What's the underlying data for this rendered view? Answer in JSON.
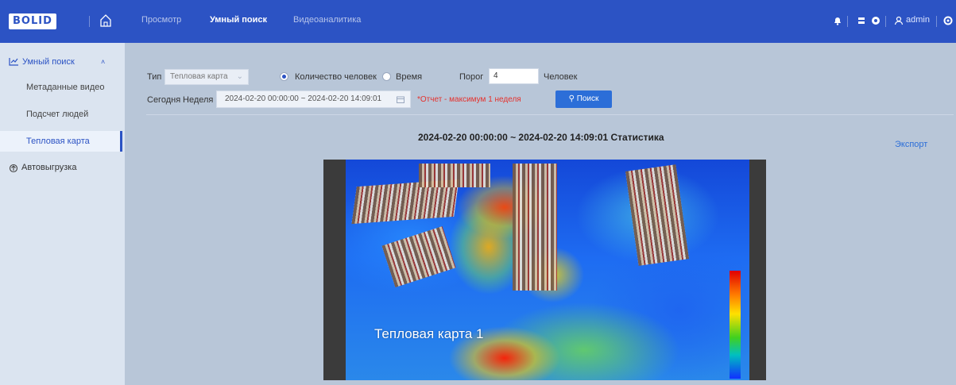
{
  "header": {
    "logo_text": "BOLID",
    "nav": [
      "Просмотр",
      "Умный поиск",
      "Видеоаналитика"
    ],
    "user": "admin"
  },
  "sidebar": {
    "group_smart_search": "Умный поиск",
    "items": [
      "Метаданные видео",
      "Подсчет людей",
      "Тепловая карта"
    ],
    "group_autoupload": "Автовыгрузка"
  },
  "filters": {
    "type_label": "Тип",
    "type_value": "Тепловая карта",
    "radio_people": "Количество человек",
    "radio_time": "Время",
    "threshold_label": "Порог",
    "threshold_value": "4",
    "threshold_unit": "Человек",
    "today": "Сегодня",
    "week": "Неделя",
    "date_range": "2024-02-20 00:00:00 ~ 2024-02-20 14:09:01",
    "warning": "*Отчет - максимум 1 неделя",
    "search_button": "Поиск"
  },
  "results": {
    "title": "2024-02-20 00:00:00 ~ 2024-02-20 14:09:01 Статистика",
    "export_label": "Экспорт",
    "heatmap_label": "Тепловая карта 1"
  },
  "colors": {
    "brand": "#2c53c4",
    "warning": "#e5312c",
    "button": "#2c6ed8"
  }
}
